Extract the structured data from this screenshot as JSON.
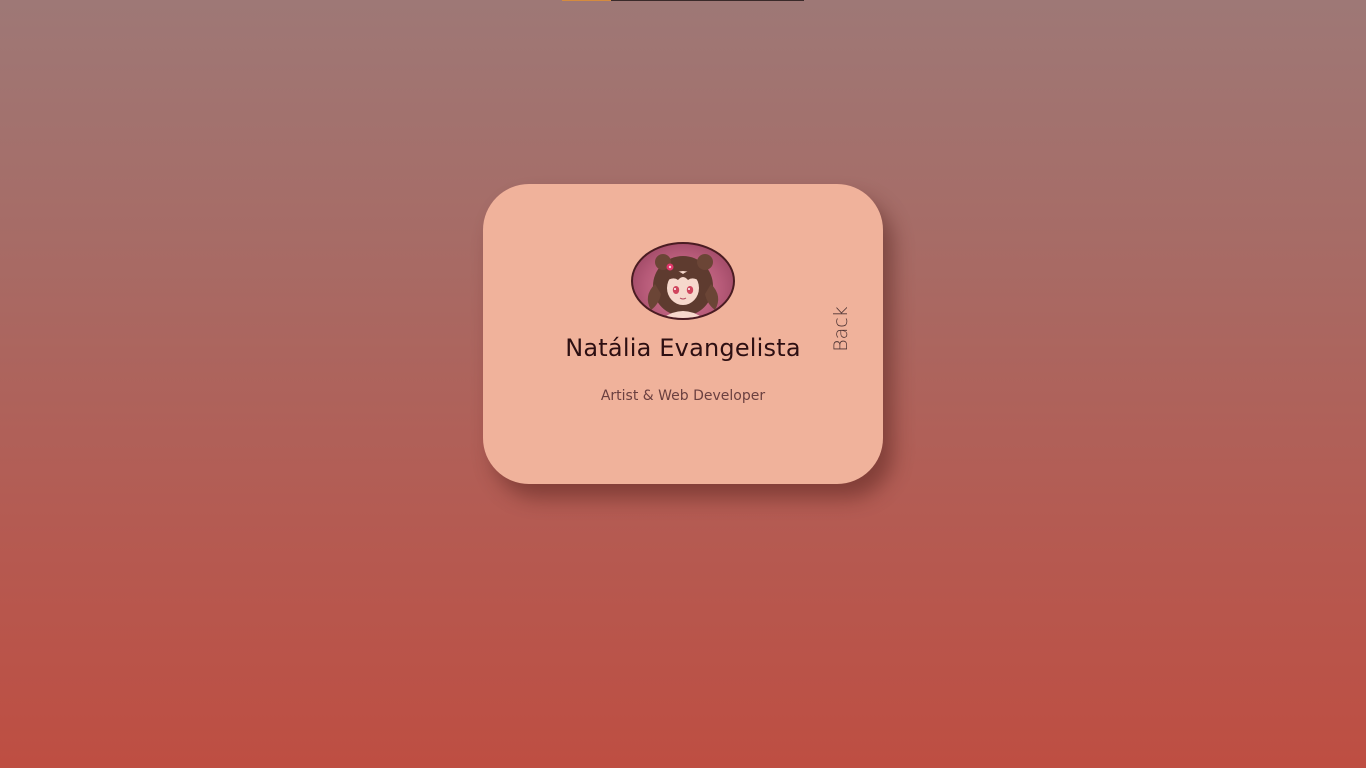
{
  "card": {
    "name": "Natália Evangelista",
    "role": "Artist & Web Developer",
    "back_label": "Back"
  },
  "colors": {
    "background_top": "#9e7876",
    "background_bottom": "#be4e42",
    "card": "#f0b29b",
    "name_text": "#2d0f12",
    "role_text": "#6b4040"
  },
  "icons": {
    "avatar": "anime-girl-avatar"
  }
}
